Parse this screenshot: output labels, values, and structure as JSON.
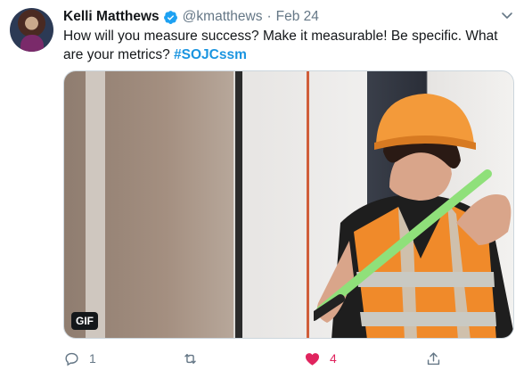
{
  "tweet": {
    "author": {
      "name": "Kelli Matthews",
      "handle": "@kmatthews",
      "verified": true
    },
    "separator": "·",
    "date": "Feb 24",
    "text": "How will you measure success? Make it measurable! Be specific. What are your metrics?",
    "hashtag": "#SOJCssm",
    "media": {
      "badge": "GIF"
    },
    "actions": {
      "reply_count": "1",
      "retweet_count": "",
      "like_count": "4",
      "liked": true
    }
  },
  "colors": {
    "text": "#14171a",
    "secondary": "#657786",
    "link": "#1b95e0",
    "like": "#e0245e",
    "verified": "#1da1f2"
  },
  "icons": [
    "caret-down-icon",
    "verified-badge-icon",
    "reply-icon",
    "retweet-icon",
    "heart-icon",
    "share-icon"
  ]
}
